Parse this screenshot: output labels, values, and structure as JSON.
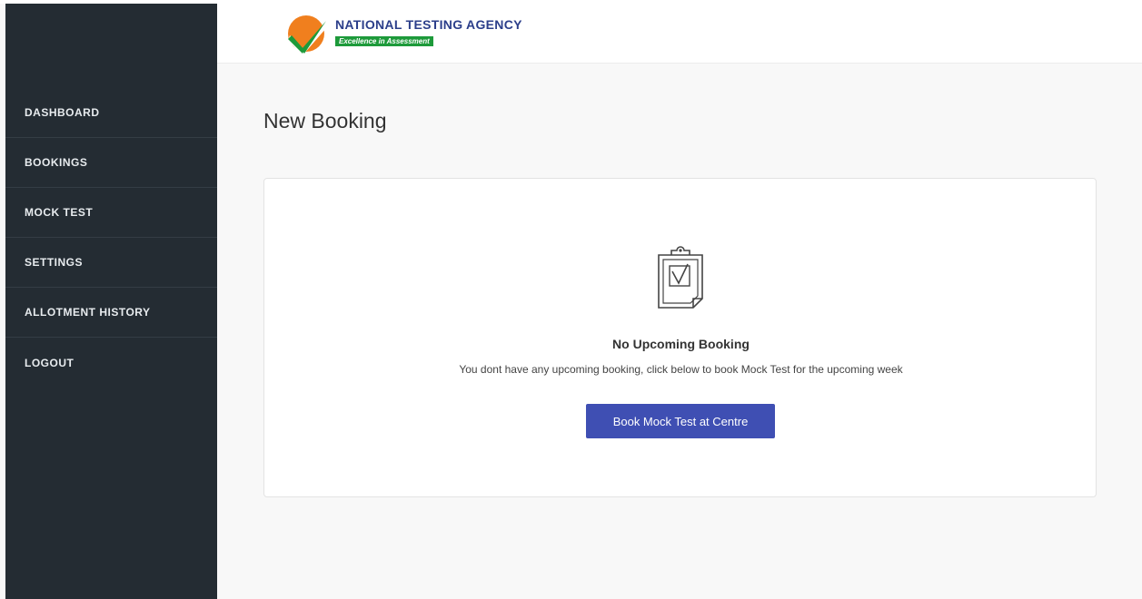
{
  "header": {
    "logo_title": "NATIONAL TESTING AGENCY",
    "logo_tagline": "Excellence in Assessment"
  },
  "sidebar": {
    "items": [
      {
        "label": "DASHBOARD"
      },
      {
        "label": "BOOKINGS"
      },
      {
        "label": "MOCK TEST"
      },
      {
        "label": "SETTINGS"
      },
      {
        "label": "ALLOTMENT HISTORY"
      },
      {
        "label": "LOGOUT"
      }
    ]
  },
  "main": {
    "page_title": "New Booking",
    "empty_state": {
      "icon": "clipboard-check-icon",
      "title": "No Upcoming Booking",
      "description": "You dont have any upcoming booking, click below to book Mock Test for the upcoming week",
      "button_label": "Book Mock Test at Centre"
    }
  },
  "colors": {
    "sidebar_bg": "#242c33",
    "primary_button": "#3f4fb3",
    "logo_blue": "#2b3e8a",
    "logo_green": "#1d9a3a",
    "logo_orange": "#f07f1e"
  }
}
